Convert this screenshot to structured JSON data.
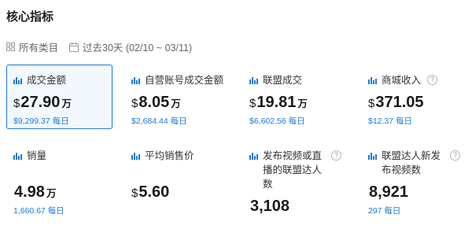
{
  "header": {
    "title": "核心指标"
  },
  "filters": {
    "category": "所有类目",
    "date_range": "过去30天 (02/10 ~ 03/11)"
  },
  "icons": {
    "metric": "bar-chart-icon",
    "category": "grid-icon",
    "date": "calendar-icon",
    "help": "question-icon"
  },
  "colors": {
    "accent": "#1e7ad6"
  },
  "metrics": [
    {
      "label": "成交金额",
      "currency": "$",
      "value": "27.90",
      "unit": "万",
      "daily": "$9,299.37 每日"
    },
    {
      "label": "自营账号成交金额",
      "currency": "$",
      "value": "8.05",
      "unit": "万",
      "daily": "$2,684.44 每日"
    },
    {
      "label": "联盟成交",
      "currency": "$",
      "value": "19.81",
      "unit": "万",
      "daily": "$6,602.56 每日"
    },
    {
      "label": "商城收入",
      "currency": "$",
      "value": "371.05",
      "unit": "",
      "daily": "$12.37 每日"
    },
    {
      "label": "销量",
      "currency": "",
      "value": "4.98",
      "unit": "万",
      "daily": "1,660.67 每日"
    },
    {
      "label": "平均销售价",
      "currency": "$",
      "value": "5.60",
      "unit": "",
      "daily": ""
    },
    {
      "label": "发布视频或直播的联盟达人数",
      "currency": "",
      "value": "3,108",
      "unit": "",
      "daily": ""
    },
    {
      "label": "联盟达人新发布视频数",
      "currency": "",
      "value": "8,921",
      "unit": "",
      "daily": "297 每日"
    }
  ]
}
